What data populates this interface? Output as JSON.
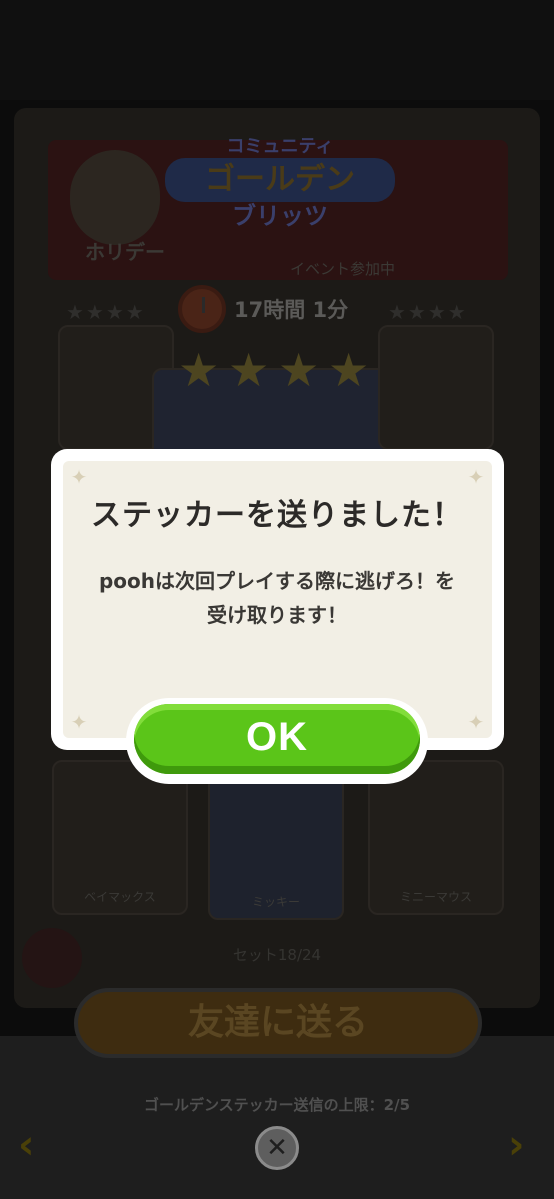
{
  "event": {
    "logo_top": "コミュニティ",
    "logo_middle": "ゴールデン",
    "logo_bottom": "ブリッツ",
    "banner_left_label": "ホリデー",
    "banner_right_label": "イベント参加中",
    "timer": "17時間 1分",
    "star_count_filled": 4
  },
  "cards": [
    {
      "label": "ベイマックス"
    },
    {
      "label": "ミッキー"
    },
    {
      "label": "ミニーマウス"
    }
  ],
  "set_progress": "セット18/24",
  "send_button": "友達に送る",
  "footer": {
    "limit_text": "ゴールデンステッカー送信の上限：2/5",
    "prev_icon": "chevron-left-icon",
    "next_icon": "chevron-right-icon",
    "close_icon": "close-icon"
  },
  "dialog": {
    "title": "ステッカーを送りました！",
    "message": "poohは次回プレイする際に逃げろ！を受け取ります！",
    "ok_label": "OK"
  },
  "colors": {
    "ok_green": "#5bc519",
    "dialog_bg": "#f2efe5",
    "overlay": "#0c0c0c"
  }
}
